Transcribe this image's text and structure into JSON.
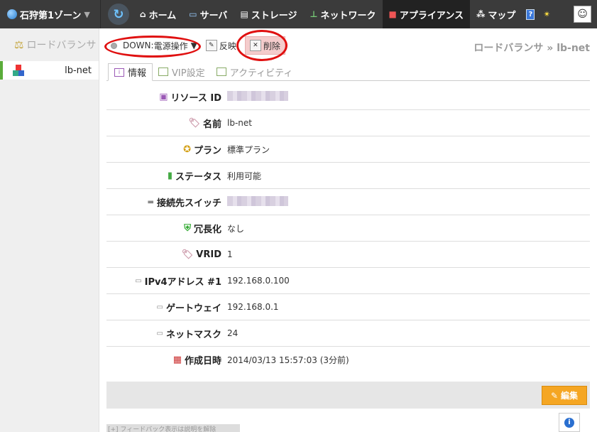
{
  "topbar": {
    "zone_label": "石狩第1ゾーン",
    "nav": [
      {
        "label": "ホーム",
        "icon": "home-icon"
      },
      {
        "label": "サーバ",
        "icon": "monitor-icon"
      },
      {
        "label": "ストレージ",
        "icon": "storage-icon"
      },
      {
        "label": "ネットワーク",
        "icon": "network-icon"
      },
      {
        "label": "アプライアンス",
        "icon": "appliance-icon"
      },
      {
        "label": "マップ",
        "icon": "map-icon"
      }
    ],
    "help_label": "?"
  },
  "sidebar": {
    "section_title": "ロードバランサ",
    "items": [
      {
        "label": "lb-net"
      }
    ]
  },
  "toolbar": {
    "status_label": "DOWN:",
    "power_label": "電源操作",
    "reflect_label": "反映",
    "delete_label": "削除"
  },
  "breadcrumb": {
    "text": "ロードバランサ » lb-net"
  },
  "tabs": [
    {
      "label": "情報"
    },
    {
      "label": "VIP設定"
    },
    {
      "label": "アクティビティ"
    }
  ],
  "details": {
    "resource_id": {
      "label": "リソース ID",
      "value": ""
    },
    "name": {
      "label": "名前",
      "value": "lb-net"
    },
    "plan": {
      "label": "プラン",
      "value": "標準プラン"
    },
    "status": {
      "label": "ステータス",
      "value": "利用可能"
    },
    "switch": {
      "label": "接続先スイッチ",
      "value": ""
    },
    "redundancy": {
      "label": "冗長化",
      "value": "なし"
    },
    "vrid": {
      "label": "VRID",
      "value": "1"
    },
    "ipv4": {
      "label": "IPv4アドレス #1",
      "value": "192.168.0.100"
    },
    "gateway": {
      "label": "ゲートウェイ",
      "value": "192.168.0.1"
    },
    "netmask": {
      "label": "ネットマスク",
      "value": "24"
    },
    "created": {
      "label": "作成日時",
      "value": "2014/03/13 15:57:03 (3分前)"
    }
  },
  "footer": {
    "edit_label": "編集",
    "feedback_text": "[+] フィードバック表示は説明を解除"
  },
  "colors": {
    "accent_orange": "#f5a623",
    "annotation_red": "#e01010",
    "sidebar_active": "#5aac3a"
  }
}
